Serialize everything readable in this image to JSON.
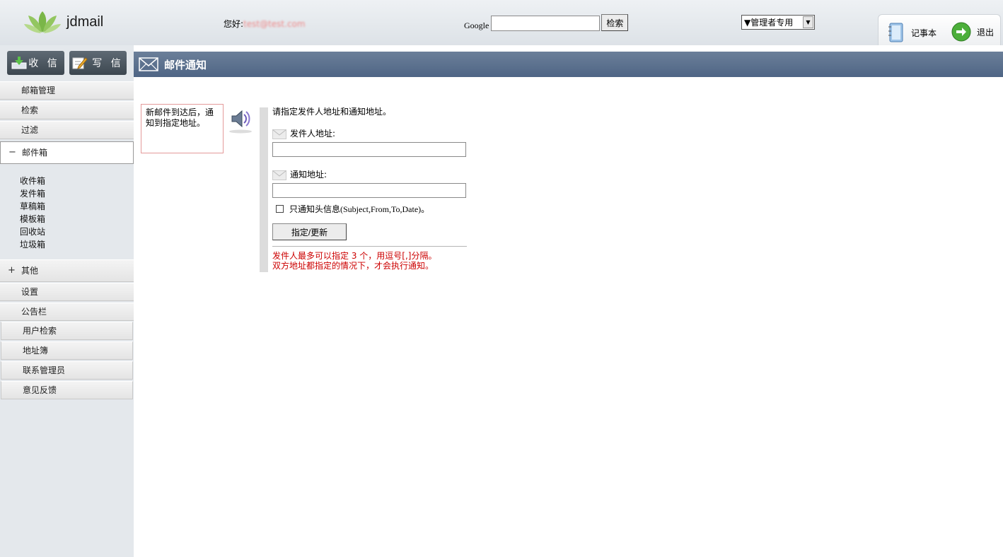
{
  "app": {
    "logo_text": "jdmail"
  },
  "topbar": {
    "greeting_prefix": "您好:",
    "user_email": "test@test.com",
    "google_label": "Google",
    "google_value": "",
    "search_button": "检索",
    "role_select": "▼管理者专用",
    "notebook_label": "记事本",
    "logout_label": "退出"
  },
  "sidebar": {
    "receive_label": "收 信",
    "compose_label": "写 信",
    "items": [
      {
        "label": "邮箱管理"
      },
      {
        "label": "检索"
      },
      {
        "label": "过滤"
      }
    ],
    "mailbox": {
      "mark": "−",
      "label": "邮件箱",
      "folders": [
        "收件箱",
        "发件箱",
        "草稿箱",
        "模板箱",
        "回收站",
        "垃圾箱"
      ]
    },
    "other": {
      "mark": "+",
      "label": "其他"
    },
    "other_items": [
      {
        "label": "设置"
      },
      {
        "label": "公告栏"
      }
    ],
    "inset_items": [
      {
        "label": "用户检索"
      },
      {
        "label": "地址簿"
      },
      {
        "label": "联系管理员"
      },
      {
        "label": "意见反馈"
      }
    ]
  },
  "main": {
    "title": "邮件通知",
    "note": "新邮件到达后，通知到指定地址。",
    "intro": "请指定发件人地址和通知地址。",
    "sender_label": "发件人地址:",
    "sender_value": "",
    "notify_label": "通知地址:",
    "notify_value": "",
    "checkbox_label_cn": "只通知头信息",
    "checkbox_label_en": "(Subject,From,To,Date)。",
    "checkbox_checked": false,
    "submit_label": "指定/更新",
    "hint1": "发件人最多可以指定 3 个，用逗号[,]分隔。",
    "hint2": "双方地址都指定的情况下，才会执行通知。"
  },
  "colors": {
    "header_bg": "#5a6f8c",
    "hint_red": "#cc0000",
    "note_border": "#e49a9a"
  }
}
